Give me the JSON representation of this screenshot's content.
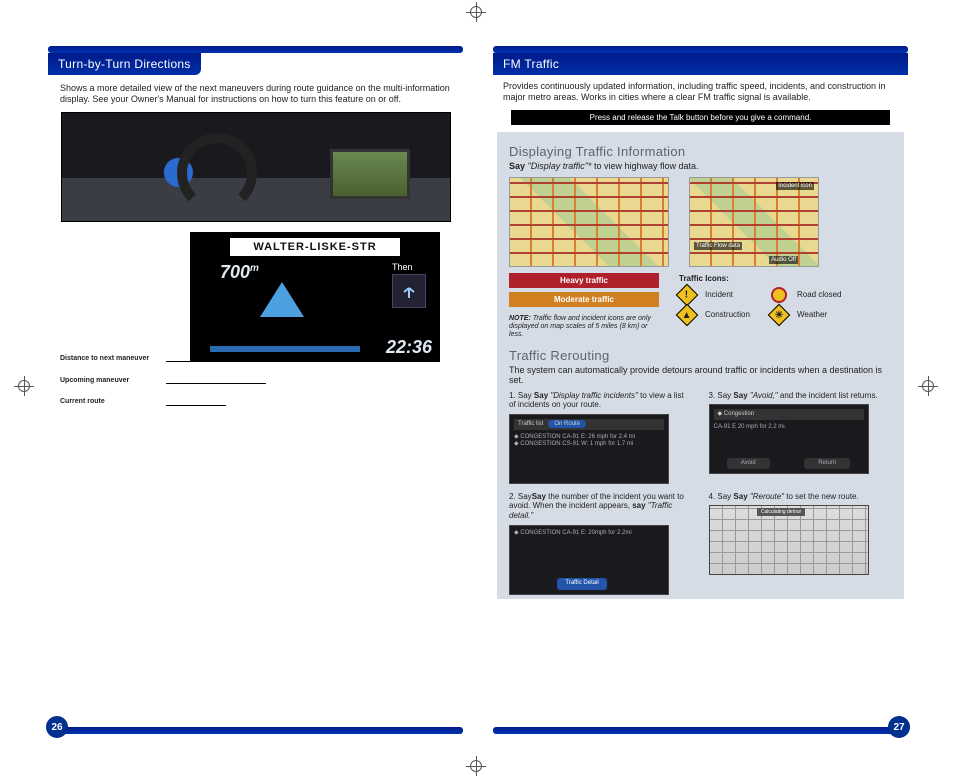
{
  "left": {
    "tab": "Turn-by-Turn Directions",
    "intro": "Shows a more detailed view of the next maneuvers during route guidance on the multi-information display. See your Owner's Manual for instructions on how to turn this feature on or off.",
    "mid": {
      "street": "WALTER-LISKE-STR",
      "distance": "700",
      "distance_unit": "m",
      "then": "Then",
      "time": "22:36"
    },
    "callouts": {
      "c1": "Distance to next maneuver",
      "c2": "Upcoming maneuver",
      "c3": "Current route"
    },
    "pagenum": "26"
  },
  "right": {
    "tab": "FM Traffic",
    "intro": "Provides continuously updated information, including traffic speed, incidents, and construction in major metro areas. Works in cities where a clear FM traffic signal is available.",
    "talkbar": "Press and release the Talk button before you give a command.",
    "section1": {
      "head": "Displaying Traffic Information",
      "say_pre": "Say",
      "say_cmd": "\"Display traffic\"*",
      "say_post": " to view highway flow data.",
      "map_labels": {
        "incident": "Incident icon",
        "flow": "Traffic Flow data",
        "audio": "Audio Off"
      },
      "legend": {
        "heavy": "Heavy traffic",
        "moderate": "Moderate traffic",
        "note_label": "NOTE:",
        "note": "Traffic flow and incident icons are only displayed on map scales of 5 miles (8 km) or less."
      },
      "icons_head": "Traffic Icons:",
      "icons": {
        "incident": "Incident",
        "road": "Road closed",
        "constr": "Construction",
        "weather": "Weather"
      }
    },
    "section2": {
      "head": "Traffic Rerouting",
      "intro": "The system can automatically provide detours around traffic or incidents when a destination is set.",
      "s1_a": "1.  Say ",
      "s1_b": "\"Display traffic incidents\"",
      "s1_c": " to view a list of incidents on your route.",
      "s2_a": "2.  Say",
      "s2_b": " the number of the incident you want to avoid. When the incident appears, ",
      "s2_c": "say",
      "s2_d": " \"Traffic detail.\"",
      "s3_a": "3.  Say ",
      "s3_b": "\"Avoid,\"",
      "s3_c": " and the incident list returns.",
      "s4_a": "4.  Say ",
      "s4_b": "\"Reroute\"",
      "s4_c": " to set the new route.",
      "img1": {
        "title": "Traffic list",
        "tab": "On Route",
        "row1": "CONGESTION  CA-91 E: 26 mph for 2.4 mi",
        "row2": "CONGESTION  CS-91 W: 1 mph for 1.7 mi"
      },
      "img2": {
        "row": "CONGESTION  CA-91 E: 20mph for 2.2mi",
        "btn": "Traffic Detail"
      },
      "img3": {
        "title": "Congestion",
        "row": "CA-91 E 20 mph for 2.2 mi.",
        "b1": "Avoid",
        "b2": "Return"
      },
      "img4": {
        "label": "Calculating detour"
      }
    },
    "pagenum": "27"
  }
}
